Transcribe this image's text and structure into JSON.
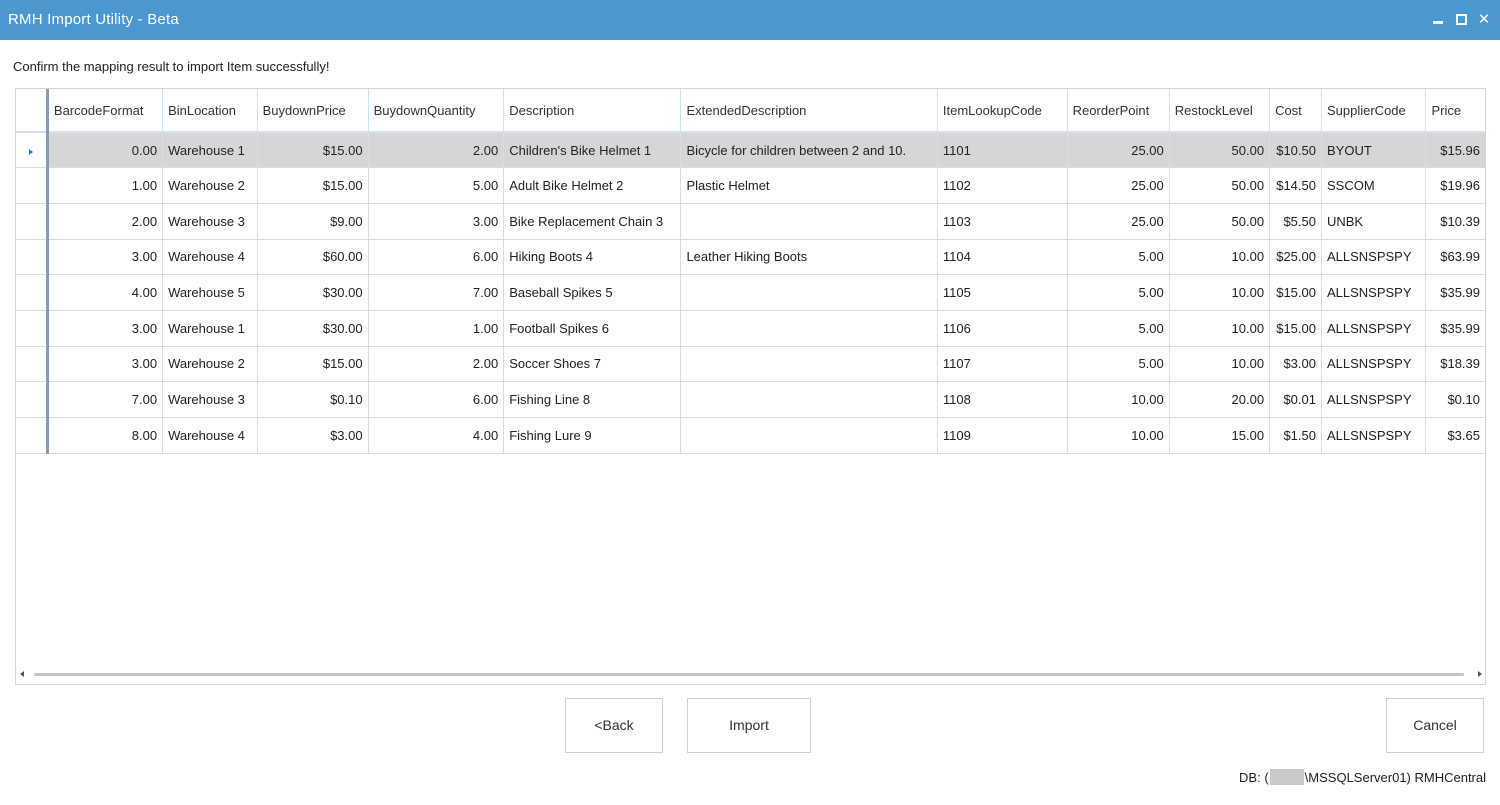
{
  "window": {
    "title": "RMH Import Utility - Beta"
  },
  "instruction": "Confirm the mapping result to import Item successfully!",
  "grid": {
    "columns": [
      "BarcodeFormat",
      "BinLocation",
      "BuydownPrice",
      "BuydownQuantity",
      "Description",
      "ExtendedDescription",
      "ItemLookupCode",
      "ReorderPoint",
      "RestockLevel",
      "Cost",
      "SupplierCode",
      "Price"
    ],
    "rows": [
      [
        "0.00",
        "Warehouse 1",
        "$15.00",
        "2.00",
        "Children's Bike Helmet 1",
        "Bicycle for children between 2 and 10.",
        "1101",
        "25.00",
        "50.00",
        "$10.50",
        "BYOUT",
        "$15.96"
      ],
      [
        "1.00",
        "Warehouse 2",
        "$15.00",
        "5.00",
        "Adult Bike Helmet 2",
        "Plastic Helmet",
        "1102",
        "25.00",
        "50.00",
        "$14.50",
        "SSCOM",
        "$19.96"
      ],
      [
        "2.00",
        "Warehouse 3",
        "$9.00",
        "3.00",
        "Bike Replacement Chain 3",
        "",
        "1103",
        "25.00",
        "50.00",
        "$5.50",
        "UNBK",
        "$10.39"
      ],
      [
        "3.00",
        "Warehouse 4",
        "$60.00",
        "6.00",
        "Hiking Boots 4",
        "Leather Hiking Boots",
        "1104",
        "5.00",
        "10.00",
        "$25.00",
        "ALLSNSPSPY",
        "$63.99"
      ],
      [
        "4.00",
        "Warehouse 5",
        "$30.00",
        "7.00",
        "Baseball Spikes 5",
        "",
        "1105",
        "5.00",
        "10.00",
        "$15.00",
        "ALLSNSPSPY",
        "$35.99"
      ],
      [
        "3.00",
        "Warehouse 1",
        "$30.00",
        "1.00",
        "Football Spikes 6",
        "",
        "1106",
        "5.00",
        "10.00",
        "$15.00",
        "ALLSNSPSPY",
        "$35.99"
      ],
      [
        "3.00",
        "Warehouse 2",
        "$15.00",
        "2.00",
        "Soccer Shoes 7",
        "",
        "1107",
        "5.00",
        "10.00",
        "$3.00",
        "ALLSNSPSPY",
        "$18.39"
      ],
      [
        "7.00",
        "Warehouse 3",
        "$0.10",
        "6.00",
        "Fishing Line 8",
        "",
        "1108",
        "10.00",
        "20.00",
        "$0.01",
        "ALLSNSPSPY",
        "$0.10"
      ],
      [
        "8.00",
        "Warehouse 4",
        "$3.00",
        "4.00",
        "Fishing Lure 9",
        "",
        "1109",
        "10.00",
        "15.00",
        "$1.50",
        "ALLSNSPSPY",
        "$3.65"
      ]
    ],
    "selected_row_index": 0
  },
  "buttons": {
    "back": "<Back",
    "import": "Import",
    "cancel": "Cancel"
  },
  "status": {
    "db_prefix": "DB: (",
    "db_suffix": "\\MSSQLServer01) RMHCentral"
  },
  "icons": {
    "minimize": "minimize-icon",
    "maximize": "maximize-icon",
    "close": "close-icon",
    "row_indicator": "row-pointer-icon"
  },
  "colors": {
    "titlebar": "#4b97d0",
    "selected_row": "#d6d6d6"
  }
}
